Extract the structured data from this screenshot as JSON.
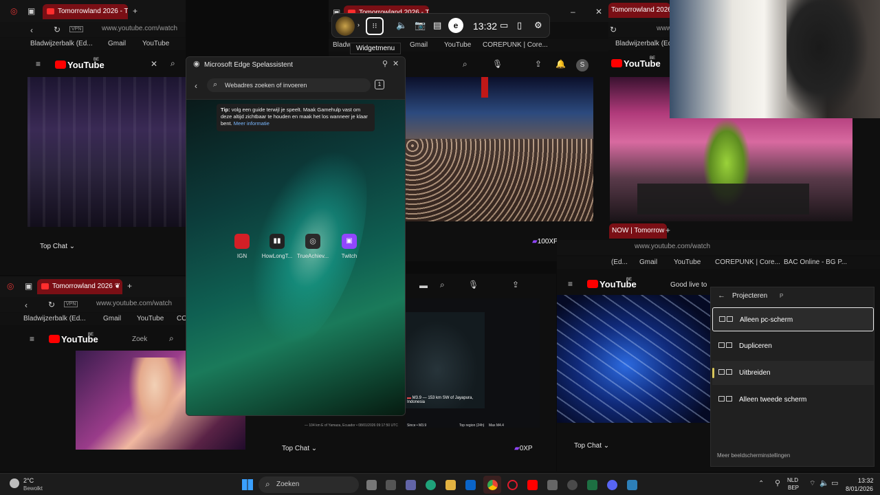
{
  "gamebar": {
    "time": "13:32",
    "tooltip": "Widgetmenu",
    "icons": [
      "game-logo-icon",
      "widget-menu-icon",
      "volume-icon",
      "camera-icon",
      "performance-icon",
      "edge-assistant-icon",
      "battery-icon",
      "mouse-icon",
      "settings-icon"
    ]
  },
  "edge_assistant": {
    "title": "Microsoft Edge Spelassistent",
    "search_placeholder": "Webadres zoeken of invoeren",
    "tab_count": "1",
    "tip_label": "Tip:",
    "tip_text": "volg een guide terwijl je speelt. Maak Gamehulp vast om deze altijd zichtbaar te houden en maak het los wanneer je klaar bent.",
    "tip_link": "Meer informatie",
    "shortcuts": [
      {
        "label": "IGN",
        "color": "#d31f26"
      },
      {
        "label": "HowLongT...",
        "color": "#222222"
      },
      {
        "label": "TrueAchiev...",
        "color": "#2a2a2a"
      },
      {
        "label": "Twitch",
        "color": "#9146ff"
      }
    ]
  },
  "browsers": {
    "top_left": {
      "tab_title": "Tomorrowland 2026 - Tie",
      "url": "www.youtube.com/watch",
      "vpn": "VPN",
      "bookmarks": [
        "Bladwijzerbalk (Ed...",
        "Gmail",
        "YouTube",
        "COREPUNK | Core..."
      ],
      "yt_logo": "YouTube",
      "yt_region": "BE",
      "top_chat": "Top Chat"
    },
    "top_middle": {
      "tab_title": "Tomorrowland 2026 - Tie",
      "bookmarks": [
        "Bladw",
        "Gmail",
        "YouTube",
        "COREPUNK | Core..."
      ],
      "avatar": "S",
      "xp": "100XP"
    },
    "top_right": {
      "tab_title": "Tomorrowland 2026 - Tie",
      "url": "www",
      "bookmarks": [
        "Bladwijzerbalk (Ed..."
      ],
      "yt_logo": "YouTube",
      "yt_region": "BE"
    },
    "bottom_left": {
      "tab_title": "Tomorrowland 2026 ❦ D.i",
      "url": "www.youtube.com/watch",
      "vpn": "VPN",
      "bookmarks": [
        "Bladwijzerbalk (Ed...",
        "Gmail",
        "YouTube",
        "CO"
      ],
      "yt_logo": "YouTube",
      "yt_region": "BE",
      "search": "Zoek"
    },
    "bottom_middle": {
      "top_chat": "Top Chat",
      "xp": "0XP",
      "quake_headline": "M3.9 — 153 km SW of Jayapura, Indonesia",
      "quake_ticker": "— 104 km E of Yamaza, Ecuador • 08/01/2026 09:17:50 UTC",
      "quake_sub": "Since • M3.9",
      "quake_region": "Top region (24h)",
      "quake_magnitude": "Max M4.4"
    },
    "bottom_right": {
      "tab_title": "NOW | Tomorrow",
      "url": "www.youtube.com/watch",
      "bookmarks": [
        "(Ed...",
        "Gmail",
        "YouTube",
        "COREPUNK | Core...",
        "BAC Online - BG P..."
      ],
      "yt_logo": "YouTube",
      "yt_region": "BE",
      "search": "Good live to",
      "top_chat": "Top Chat"
    }
  },
  "projecteren": {
    "title": "Projecteren",
    "shortcut": "P",
    "options": [
      "Alleen pc-scherm",
      "Dupliceren",
      "Uitbreiden",
      "Alleen tweede scherm"
    ],
    "selected": "Alleen pc-scherm",
    "footer": "Meer beeldscherminstellingen"
  },
  "taskbar": {
    "weather_temp": "2°C",
    "weather_desc": "Bewolkt",
    "search": "Zoeken",
    "lang_top": "NLD",
    "lang_bottom": "BEP",
    "clock_time": "13:32",
    "clock_date": "8/01/2026"
  },
  "colors": {
    "youtube_red": "#ff0000",
    "tab_red": "#7a0f15",
    "twitch_purple": "#9146ff",
    "accent_teal": "#1fd3c0"
  }
}
